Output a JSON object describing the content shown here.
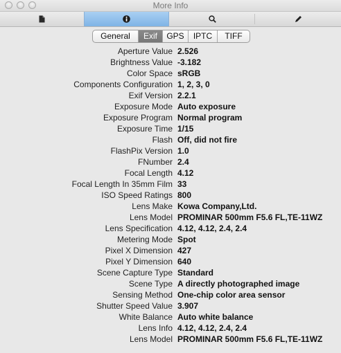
{
  "window": {
    "title": "More Info"
  },
  "toolbar": {
    "buttons": [
      {
        "icon": "document-icon"
      },
      {
        "icon": "info-icon",
        "selected": true
      },
      {
        "icon": "search-icon"
      },
      {
        "icon": "pen-icon"
      }
    ]
  },
  "tabs": [
    {
      "label": "General",
      "active": false
    },
    {
      "label": "Exif",
      "active": true
    },
    {
      "label": "GPS",
      "active": false
    },
    {
      "label": "IPTC",
      "active": false
    },
    {
      "label": "TIFF",
      "active": false
    }
  ],
  "rows": [
    {
      "label": "Aperture Value",
      "value": "2.526"
    },
    {
      "label": "Brightness Value",
      "value": "-3.182"
    },
    {
      "label": "Color Space",
      "value": "sRGB"
    },
    {
      "label": "Components Configuration",
      "value": "1, 2, 3, 0"
    },
    {
      "label": "Exif Version",
      "value": "2.2.1"
    },
    {
      "label": "Exposure Mode",
      "value": "Auto exposure"
    },
    {
      "label": "Exposure Program",
      "value": "Normal program"
    },
    {
      "label": "Exposure Time",
      "value": "1/15"
    },
    {
      "label": "Flash",
      "value": "Off, did not fire"
    },
    {
      "label": "FlashPix Version",
      "value": "1.0"
    },
    {
      "label": "FNumber",
      "value": "2.4"
    },
    {
      "label": "Focal Length",
      "value": "4.12"
    },
    {
      "label": "Focal Length In 35mm Film",
      "value": "33"
    },
    {
      "label": "ISO Speed Ratings",
      "value": "800"
    },
    {
      "label": "Lens Make",
      "value": "Kowa Company,Ltd."
    },
    {
      "label": "Lens Model",
      "value": "PROMINAR 500mm F5.6 FL,TE-11WZ"
    },
    {
      "label": "Lens Specification",
      "value": "4.12, 4.12, 2.4, 2.4"
    },
    {
      "label": "Metering Mode",
      "value": "Spot"
    },
    {
      "label": "Pixel X Dimension",
      "value": "427"
    },
    {
      "label": "Pixel Y Dimension",
      "value": "640"
    },
    {
      "label": "Scene Capture Type",
      "value": "Standard"
    },
    {
      "label": "Scene Type",
      "value": "A directly photographed image"
    },
    {
      "label": "Sensing Method",
      "value": "One-chip color area sensor"
    },
    {
      "label": "Shutter Speed Value",
      "value": "3.907"
    },
    {
      "label": "White Balance",
      "value": "Auto white balance"
    },
    {
      "label": "Lens Info",
      "value": "4.12, 4.12, 2.4, 2.4"
    },
    {
      "label": "Lens Model",
      "value": "PROMINAR 500mm F5.6 FL,TE-11WZ"
    }
  ]
}
